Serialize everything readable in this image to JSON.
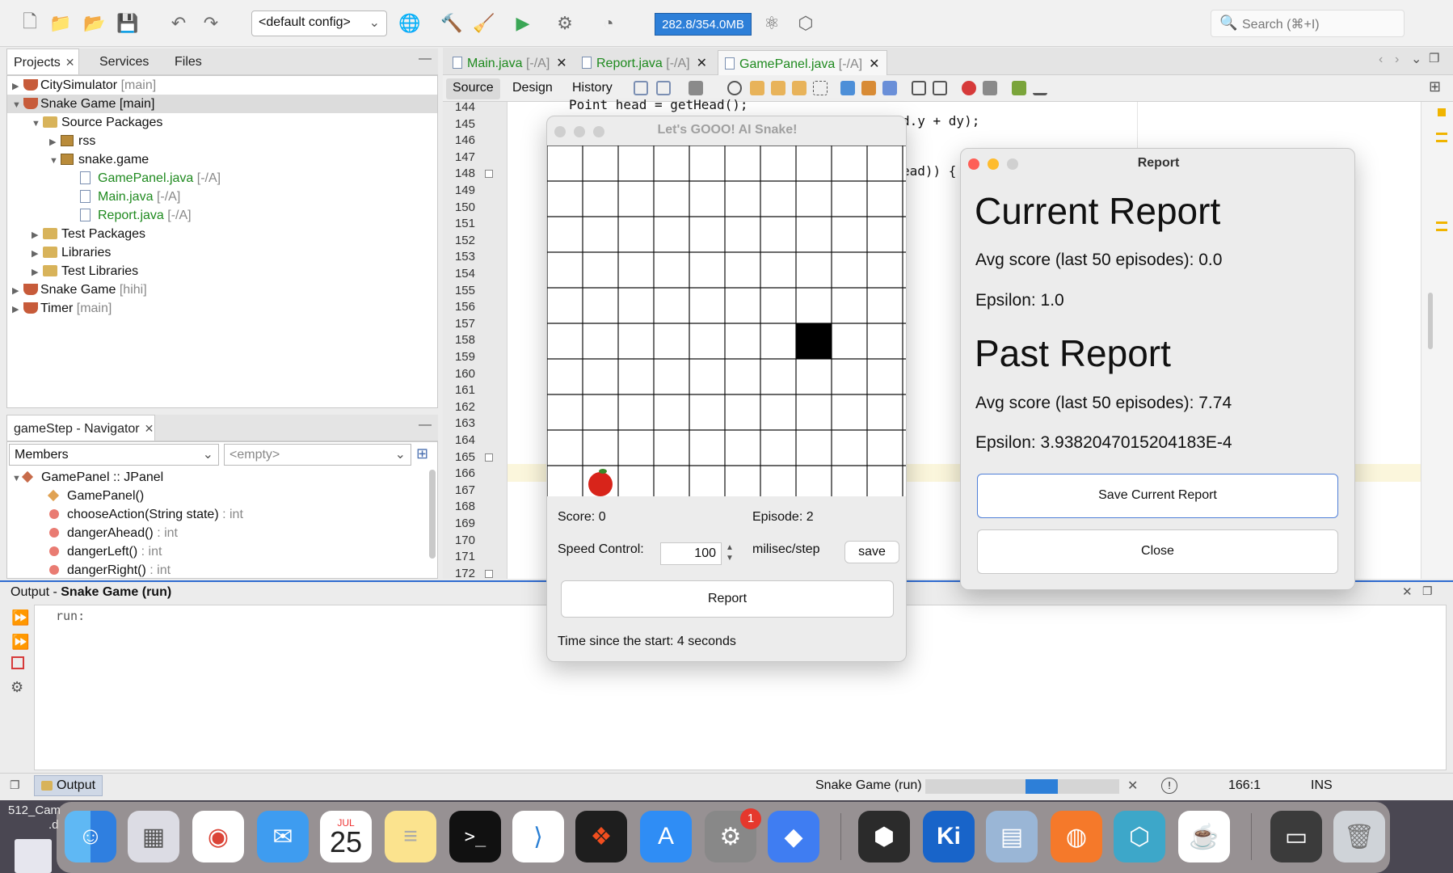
{
  "toolbar": {
    "config": "<default config>",
    "memory": "282.8/354.0MB",
    "search_placeholder": "Search (⌘+I)"
  },
  "projects_panel": {
    "tabs": [
      "Projects",
      "Services",
      "Files"
    ],
    "tree": [
      {
        "label": "CitySimulator",
        "suffix": "[main]"
      },
      {
        "label": "Snake Game [main]",
        "suffix": ""
      },
      {
        "label": "Source Packages",
        "suffix": ""
      },
      {
        "label": "rss",
        "suffix": ""
      },
      {
        "label": "snake.game",
        "suffix": ""
      },
      {
        "label": "GamePanel.java",
        "suffix": "[-/A]"
      },
      {
        "label": "Main.java",
        "suffix": "[-/A]"
      },
      {
        "label": "Report.java",
        "suffix": "[-/A]"
      },
      {
        "label": "Test Packages",
        "suffix": ""
      },
      {
        "label": "Libraries",
        "suffix": ""
      },
      {
        "label": "Test Libraries",
        "suffix": ""
      },
      {
        "label": "Snake Game",
        "suffix": "[hihi]"
      },
      {
        "label": "Timer",
        "suffix": "[main]"
      }
    ]
  },
  "navigator": {
    "title": "gameStep - Navigator",
    "filter": "Members",
    "filter2": "<empty>",
    "items": [
      {
        "label": "GamePanel :: JPanel",
        "type": ""
      },
      {
        "label": "GamePanel()",
        "type": ""
      },
      {
        "label": "chooseAction(String state)",
        "type": ": int"
      },
      {
        "label": "dangerAhead()",
        "type": ": int"
      },
      {
        "label": "dangerLeft()",
        "type": ": int"
      },
      {
        "label": "dangerRight()",
        "type": ": int"
      }
    ]
  },
  "editor": {
    "tabs": [
      {
        "name": "Main.java",
        "suffix": "[-/A]"
      },
      {
        "name": "Report.java",
        "suffix": "[-/A]"
      },
      {
        "name": "GamePanel.java",
        "suffix": "[-/A]"
      }
    ],
    "subtabs": [
      "Source",
      "Design",
      "History"
    ],
    "line_numbers": [
      "144",
      "145",
      "146",
      "147",
      "148",
      "149",
      "150",
      "151",
      "152",
      "153",
      "154",
      "155",
      "156",
      "157",
      "158",
      "159",
      "160",
      "161",
      "162",
      "163",
      "164",
      "165",
      "166",
      "167",
      "168",
      "169",
      "170",
      "171",
      "172"
    ],
    "code_line_1": "Point head = getHead();",
    "code_line_2": "d.y + dy);",
    "code_line_3": "ead)) {"
  },
  "output": {
    "title_prefix": "Output - ",
    "title_bold": "Snake Game (run)",
    "text": "run:"
  },
  "statusbar": {
    "output_tab": "Output",
    "process": "Snake Game (run)",
    "position": "166:1",
    "mode": "INS",
    "progress": 0.6
  },
  "game": {
    "title": "Let's GOOO! AI Snake!",
    "score_label": "Score: 0",
    "episode_label": "Episode: 2",
    "speed_label": "Speed Control:",
    "speed_value": "100",
    "unit": "milisec/step",
    "save_label": "save",
    "report_label": "Report",
    "time_label": "Time since the start: 4 seconds",
    "grid_cols": 10,
    "grid_rows": 10,
    "snake_cell": {
      "col": 7,
      "row": 5
    },
    "apple_cell": {
      "col": 1,
      "row": 9
    }
  },
  "report": {
    "title": "Report",
    "current_heading": "Current Report",
    "current_avg": "Avg score (last 50 episodes): 0.0",
    "current_eps": "Epsilon: 1.0",
    "past_heading": "Past Report",
    "past_avg": "Avg score (last 50 episodes): 7.74",
    "past_eps": "Epsilon: 3.9382047015204183E-4",
    "save_btn": "Save Current Report",
    "close_btn": "Close"
  },
  "desktop": {
    "label_1": "512_Cam",
    "label_2": ".d"
  },
  "dock": {
    "calendar_month": "JUL",
    "calendar_day": "25",
    "settings_badge": "1",
    "kite_label": "Ki",
    "colors": {
      "accent": "#2d7fd8"
    }
  }
}
